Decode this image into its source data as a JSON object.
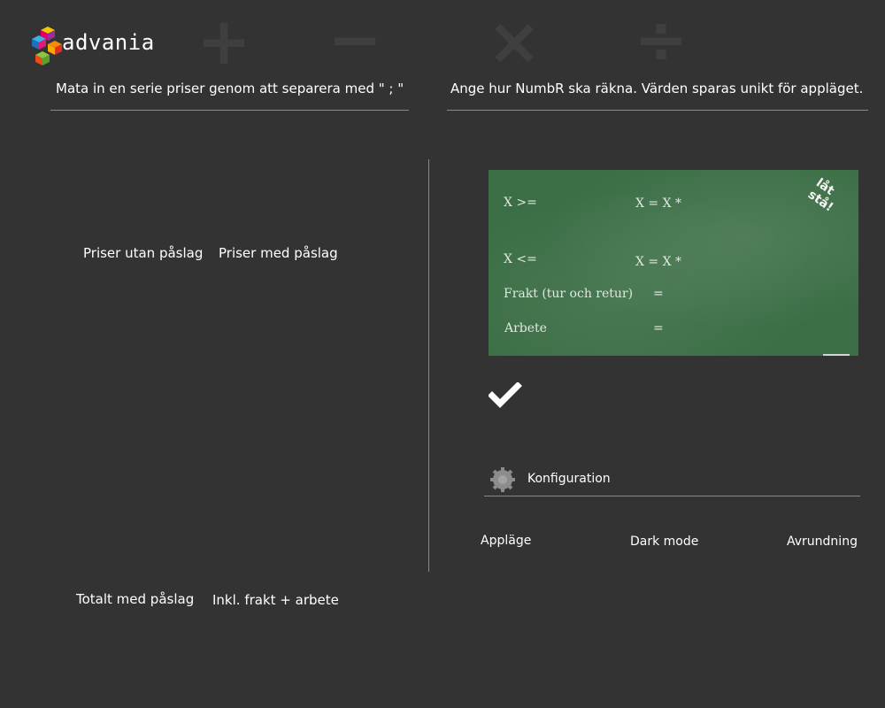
{
  "logo": {
    "name": "advania"
  },
  "operators": {
    "plus": "+",
    "minus": "−",
    "times": "×",
    "divide": "÷"
  },
  "left_panel": {
    "instruction": "Mata in en serie priser genom att separera med \" ; \"",
    "col_without_markup": "Priser utan påslag",
    "col_with_markup": "Priser med påslag",
    "total_with_markup": "Totalt med påslag",
    "incl_freight_work": "Inkl. frakt + arbete"
  },
  "right_panel": {
    "instruction": "Ange hur NumbR ska räkna. Värden sparas unikt för appläget.",
    "board": {
      "row1_left": "X >=",
      "row1_right": "X  =  X  *",
      "row2_left": "X <=",
      "row2_right": "X  =  X  *",
      "row3_left": "Frakt (tur och retur)",
      "row3_right": "=",
      "row4_left": "Arbete",
      "row4_right": "=",
      "corner_note": "låt stå!"
    },
    "config_label": "Konfiguration",
    "options": {
      "app_mode": "Appläge",
      "dark_mode": "Dark mode",
      "rounding": "Avrundning"
    }
  }
}
